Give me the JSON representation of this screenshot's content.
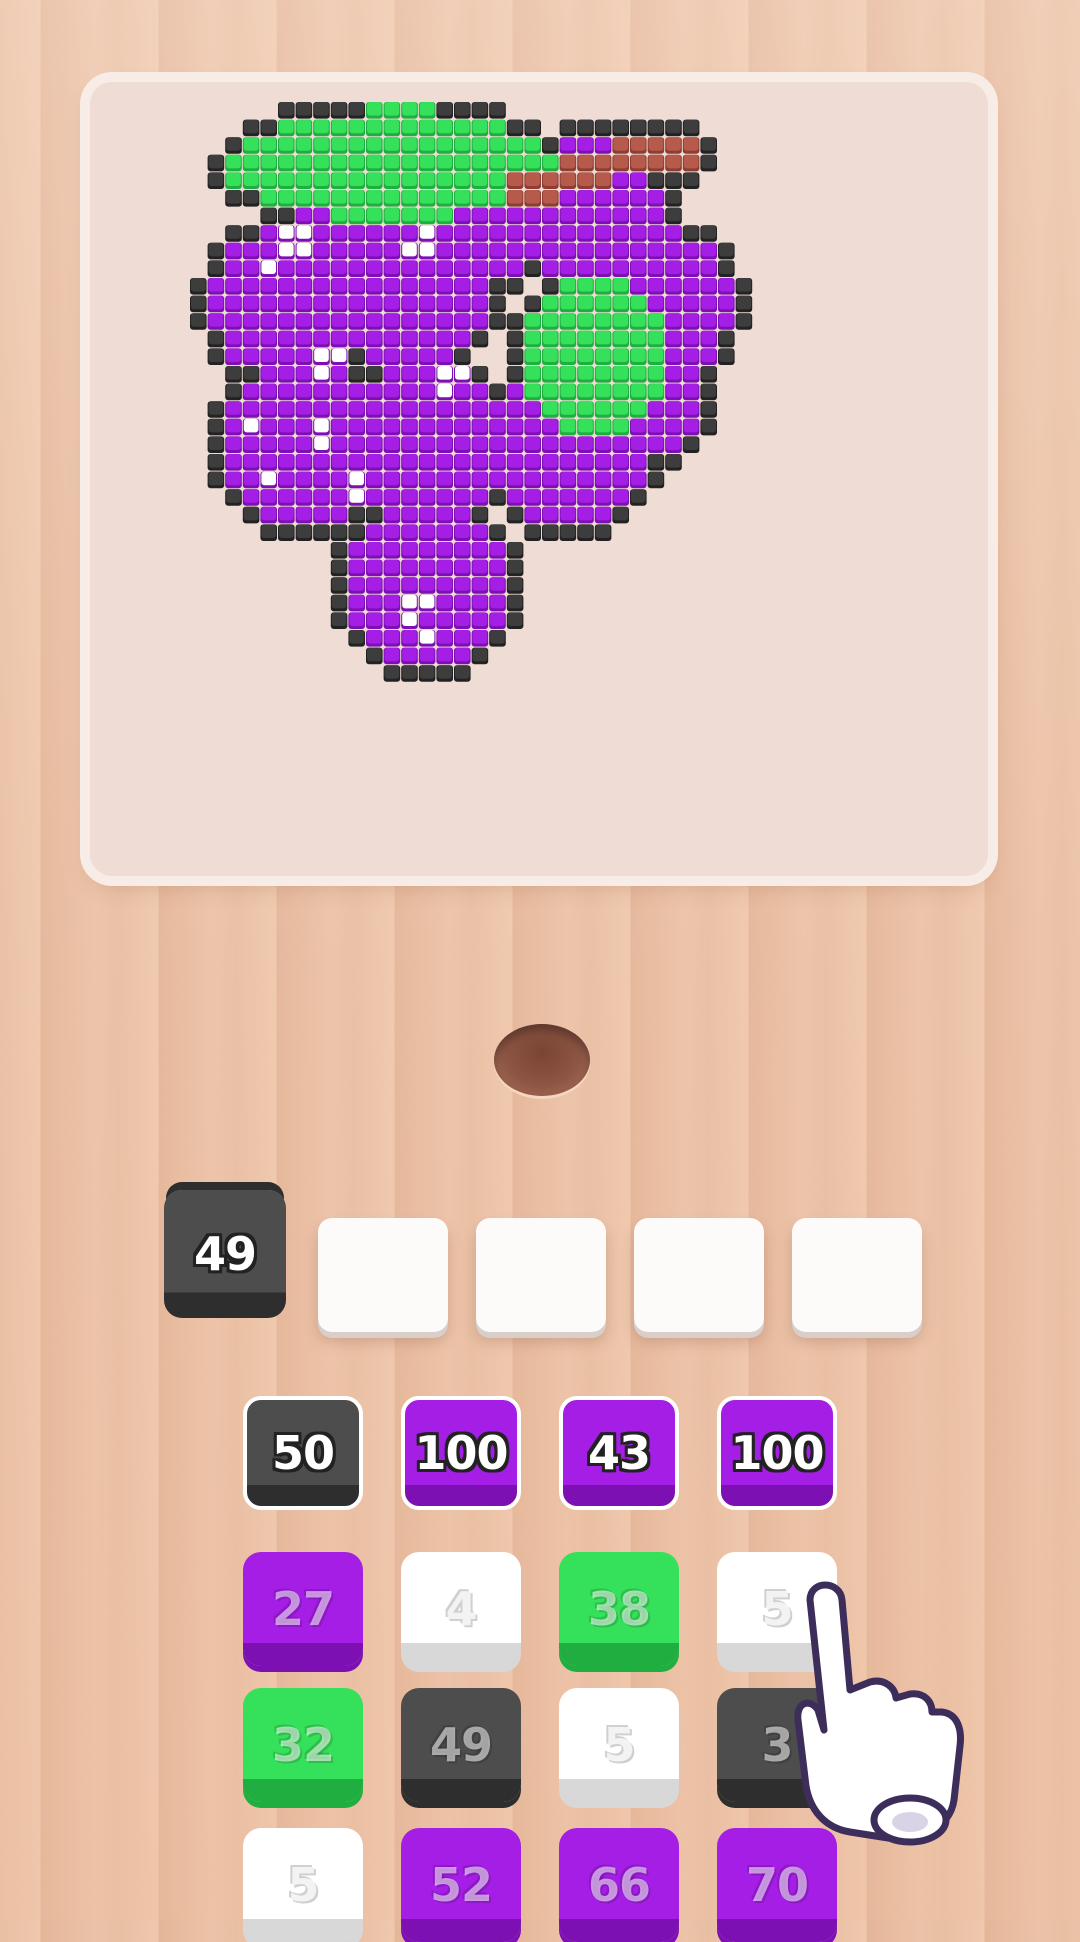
{
  "colors": {
    "purple": "#a51ee6",
    "purple_dark": "#7d10b3",
    "green": "#35e05a",
    "green_dark": "#1fae3f",
    "gray": "#4d4d4d",
    "gray_dark": "#2e2e2e",
    "white": "#ffffff",
    "white_dark": "#d8d8d8",
    "outline": "#3d3d3d",
    "stem": "#b65a4c"
  },
  "picture": {
    "subject": "grapes",
    "shine": [
      [
        5,
        7
      ],
      [
        5,
        8
      ],
      [
        6,
        7
      ],
      [
        6,
        8
      ],
      [
        4,
        9
      ],
      [
        7,
        14
      ],
      [
        7,
        15
      ],
      [
        8,
        14
      ],
      [
        7,
        18
      ],
      [
        7,
        19
      ],
      [
        4,
        21
      ],
      [
        12,
        28
      ],
      [
        13,
        28
      ],
      [
        12,
        29
      ],
      [
        13,
        30
      ],
      [
        9,
        21
      ],
      [
        9,
        22
      ],
      [
        3,
        23
      ],
      [
        14,
        15
      ],
      [
        15,
        15
      ],
      [
        14,
        16
      ],
      [
        3,
        18
      ],
      [
        12,
        8
      ],
      [
        13,
        8
      ],
      [
        13,
        7
      ],
      [
        7,
        25
      ]
    ]
  },
  "holder": {
    "tile": {
      "value": "49",
      "color": "gray"
    },
    "empty_slots": 4
  },
  "grid": [
    [
      {
        "value": "50",
        "color": "gray",
        "front": true
      },
      {
        "value": "100",
        "color": "purple",
        "front": true
      },
      {
        "value": "43",
        "color": "purple",
        "front": true
      },
      {
        "value": "100",
        "color": "purple",
        "front": true
      }
    ],
    [
      {
        "value": "27",
        "color": "purple",
        "front": false
      },
      {
        "value": "4",
        "color": "white",
        "front": false
      },
      {
        "value": "38",
        "color": "green",
        "front": false
      },
      {
        "value": "5",
        "color": "white",
        "front": false
      }
    ],
    [
      {
        "value": "32",
        "color": "green",
        "front": false
      },
      {
        "value": "49",
        "color": "gray",
        "front": false
      },
      {
        "value": "5",
        "color": "white",
        "front": false
      },
      {
        "value": "3",
        "color": "gray",
        "front": false
      }
    ],
    [
      {
        "value": "5",
        "color": "white",
        "front": false
      },
      {
        "value": "52",
        "color": "purple",
        "front": false
      },
      {
        "value": "66",
        "color": "purple",
        "front": false
      },
      {
        "value": "70",
        "color": "purple",
        "front": false
      }
    ]
  ]
}
